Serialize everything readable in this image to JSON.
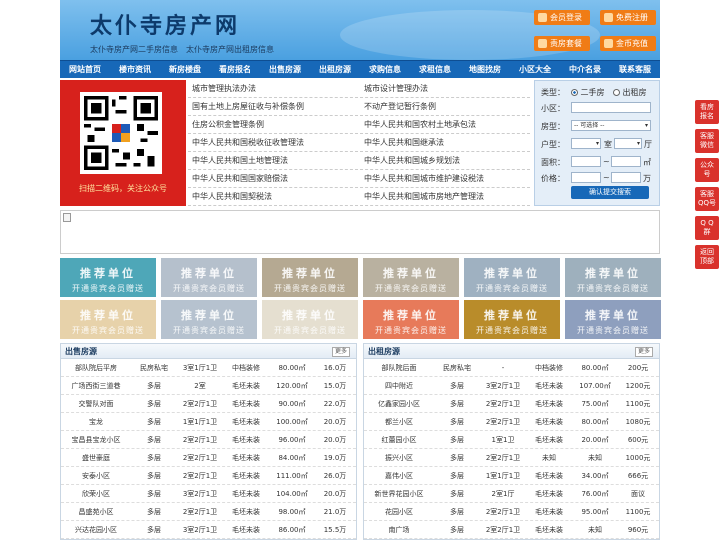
{
  "header": {
    "title": "太仆寺房产网",
    "subtitle": "太仆寺房产网二手房信息　太仆寺房产网出租房信息",
    "buttons": [
      "会员登录",
      "免费注册",
      "责房套餐",
      "金币充值"
    ]
  },
  "nav": [
    "网站首页",
    "楼市资讯",
    "新房楼盘",
    "看房报名",
    "出售房源",
    "出租房源",
    "求购信息",
    "求租信息",
    "地图找房",
    "小区大全",
    "中介名录",
    "联系客服"
  ],
  "qr": {
    "caption": "扫描二维码，关注公众号"
  },
  "laws": [
    [
      "城市管理执法办法",
      "城市设计管理办法"
    ],
    [
      "国有土地上房屋征收与补偿条例",
      "不动产登记暂行条例"
    ],
    [
      "住房公积金管理条例",
      "中华人民共和国农村土地承包法"
    ],
    [
      "中华人民共和国税收征收管理法",
      "中华人民共和国继承法"
    ],
    [
      "中华人民共和国土地管理法",
      "中华人民共和国城乡规划法"
    ],
    [
      "中华人民共和国国家赔偿法",
      "中华人民共和国城市维护建设税法"
    ],
    [
      "中华人民共和国契税法",
      "中华人民共和国城市房地产管理法"
    ]
  ],
  "search": {
    "type_label": "类型：",
    "type_opt1": "二手房",
    "type_opt2": "出租房",
    "community_label": "小区：",
    "house_label": "房型：",
    "house_select": "-- 可选择 --",
    "layout_label": "户型：",
    "room": "室",
    "hall": "厅",
    "area_label": "面积：",
    "area_unit": "㎡",
    "price_label": "价格：",
    "price_unit": "万",
    "submit": "确认提交搜索",
    "dash": "~"
  },
  "tiles": {
    "t1": "推荐单位",
    "t2": "开通贵宾会员赠送",
    "colors": [
      "#4ea7b8",
      "#b5c0cc",
      "#b5a992",
      "#b9b1a0",
      "#9fb1c1",
      "#9eb0bd",
      "#e7d2aa",
      "#b6c2cf",
      "#e5dfd0",
      "#e77a5a",
      "#b98c2a",
      "#8e9fbe"
    ]
  },
  "sale": {
    "title": "出售房源",
    "more": "更多",
    "rows": [
      [
        "部队院后平房",
        "民房私宅",
        "3室1厅1卫",
        "中档装修",
        "80.00㎡",
        "16.0万"
      ],
      [
        "广场西街三道巷",
        "多层",
        "2室",
        "毛坯未装",
        "120.00㎡",
        "15.0万"
      ],
      [
        "交警队对面",
        "多层",
        "2室2厅1卫",
        "毛坯未装",
        "90.00㎡",
        "22.0万"
      ],
      [
        "宝龙",
        "多层",
        "1室1厅1卫",
        "毛坯未装",
        "100.00㎡",
        "20.0万"
      ],
      [
        "宝昌县宝龙小区",
        "多层",
        "2室2厅1卫",
        "毛坯未装",
        "96.00㎡",
        "20.0万"
      ],
      [
        "盛世豪庭",
        "多层",
        "2室2厅1卫",
        "毛坯未装",
        "84.00㎡",
        "19.0万"
      ],
      [
        "安泰小区",
        "多层",
        "2室2厅1卫",
        "毛坯未装",
        "111.00㎡",
        "26.0万"
      ],
      [
        "欣荣小区",
        "多层",
        "3室2厅1卫",
        "毛坯未装",
        "104.00㎡",
        "20.0万"
      ],
      [
        "昌盛苑小区",
        "多层",
        "2室2厅1卫",
        "毛坯未装",
        "98.00㎡",
        "21.0万"
      ],
      [
        "兴达花园小区",
        "多层",
        "3室2厅1卫",
        "毛坯未装",
        "86.00㎡",
        "15.5万"
      ]
    ]
  },
  "rent": {
    "title": "出租房源",
    "more": "更多",
    "rows": [
      [
        "部队院后面",
        "民房私宅",
        "-",
        "中档装修",
        "80.00㎡",
        "200元"
      ],
      [
        "四中附近",
        "多层",
        "3室2厅1卫",
        "毛坯未装",
        "107.00㎡",
        "1200元"
      ],
      [
        "亿鑫家园小区",
        "多层",
        "2室2厅1卫",
        "毛坯未装",
        "75.00㎡",
        "1100元"
      ],
      [
        "都兰小区",
        "多层",
        "2室2厅1卫",
        "毛坯未装",
        "80.00㎡",
        "1080元"
      ],
      [
        "红蕾园小区",
        "多层",
        "1室1卫",
        "毛坯未装",
        "20.00㎡",
        "600元"
      ],
      [
        "振兴小区",
        "多层",
        "2室2厅1卫",
        "未知",
        "未知",
        "1000元"
      ],
      [
        "嘉伟小区",
        "多层",
        "1室1厅1卫",
        "毛坯未装",
        "34.00㎡",
        "666元"
      ],
      [
        "新世界花园小区",
        "多层",
        "2室1厅",
        "毛坯未装",
        "76.00㎡",
        "面议"
      ],
      [
        "花园小区",
        "多层",
        "2室2厅1卫",
        "毛坯未装",
        "95.00㎡",
        "1100元"
      ],
      [
        "南广场",
        "多层",
        "2室2厅1卫",
        "毛坯未装",
        "未知",
        "960元"
      ]
    ]
  },
  "sidebar": [
    [
      "看房",
      "报名"
    ],
    [
      "客服",
      "微信"
    ],
    [
      "公众",
      "号"
    ],
    [
      "客服",
      "QQ号"
    ],
    [
      "Q Q",
      "群"
    ],
    [
      "返回",
      "顶部"
    ]
  ]
}
